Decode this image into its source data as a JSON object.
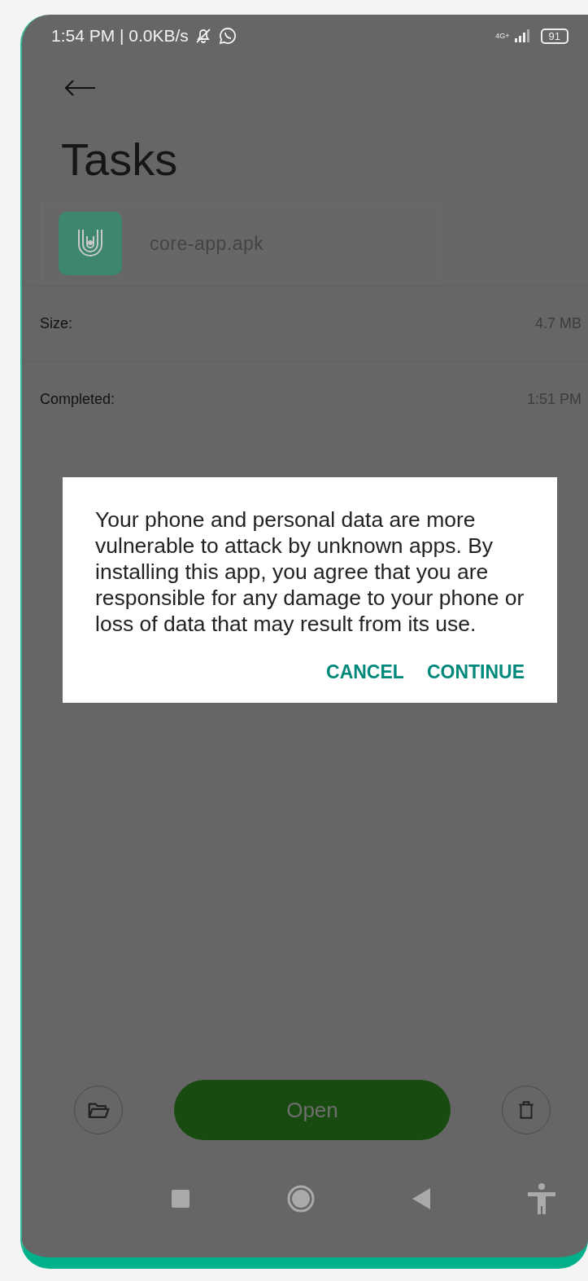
{
  "status_bar": {
    "time": "1:54 PM | 0.0KB/s",
    "network": "4G+",
    "battery": "91"
  },
  "title": "Tasks",
  "file": {
    "name": "core-app.apk"
  },
  "details": [
    {
      "label": "Size:",
      "value": "4.7 MB"
    },
    {
      "label": "Completed:",
      "value": "1:51 PM"
    }
  ],
  "dialog": {
    "message": "Your phone and personal data are more vulnerable to attack by unknown apps. By installing this app, you agree that you are responsible for any damage to your phone or loss of data that may result from its use.",
    "buttons": [
      "CANCEL",
      "CONTINUE"
    ]
  },
  "actions": {
    "open": "Open"
  }
}
